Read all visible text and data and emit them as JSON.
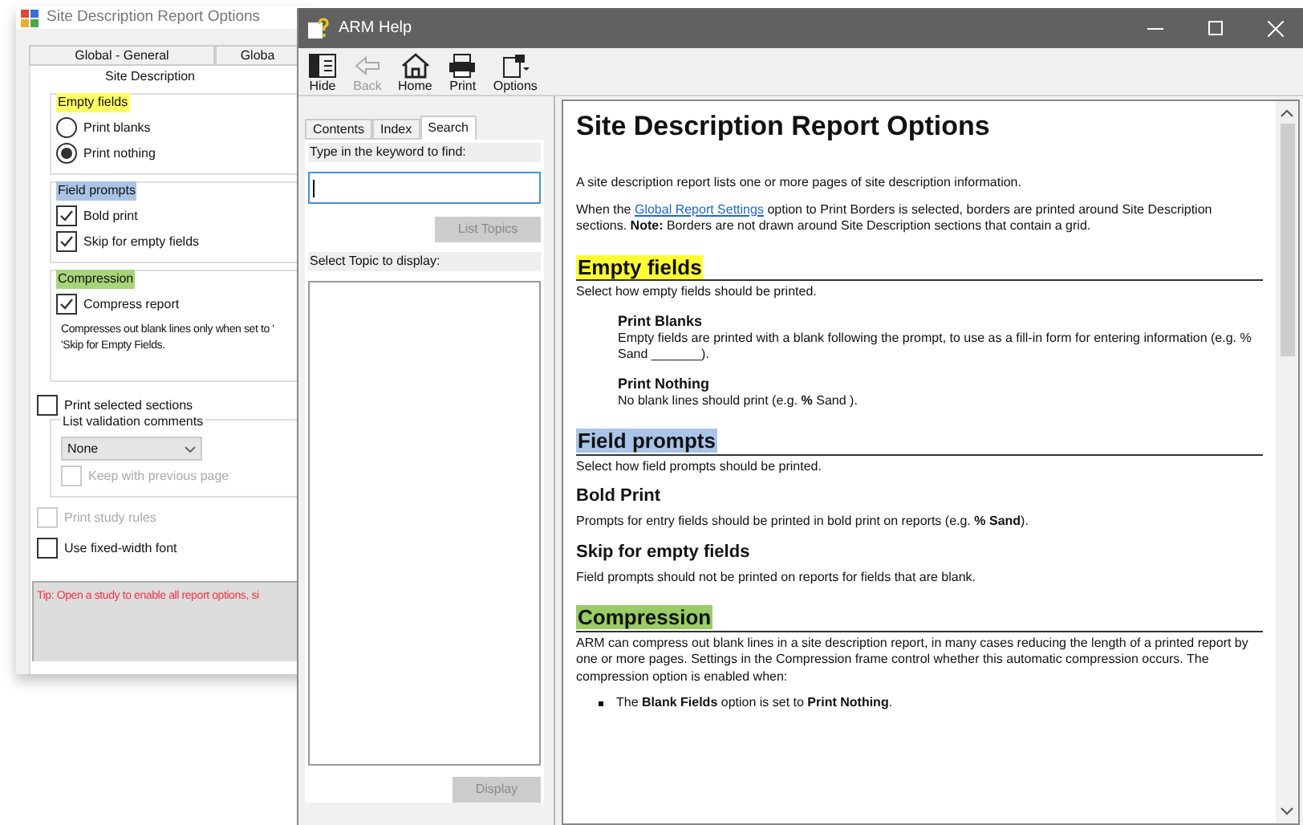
{
  "options_window": {
    "title": "Site Description Report Options",
    "tabs": [
      {
        "label": "Global - General",
        "selected": false
      },
      {
        "label": "Globa",
        "selected": false
      }
    ],
    "active_tab": {
      "label": "Site Description",
      "selected": true
    },
    "groups": [
      {
        "legend": "Empty fields",
        "color": "#ffff66",
        "items": [
          {
            "kind": "radio",
            "label": "Print blanks",
            "checked": false
          },
          {
            "kind": "radio",
            "label": "Print nothing",
            "checked": true
          }
        ]
      },
      {
        "legend": "Field prompts",
        "color": "#a9c4e6",
        "items": [
          {
            "kind": "checkbox",
            "label": "Bold print",
            "checked": true
          },
          {
            "kind": "checkbox",
            "label": "Skip for empty fields",
            "checked": true
          }
        ]
      },
      {
        "legend": "Compression",
        "color": "#a6d57a",
        "items": [
          {
            "kind": "checkbox",
            "label": "Compress report",
            "checked": true
          }
        ],
        "note": [
          "Compresses out blank lines only when set to '",
          "'Skip for Empty Fields."
        ]
      }
    ],
    "print_selected": {
      "label": "Print selected sections",
      "checked": false,
      "disabled": false
    },
    "validation": {
      "legend": "List validation comments",
      "value": "None",
      "keep": {
        "label": "Keep with previous page",
        "checked": false,
        "disabled": true
      }
    },
    "study_rules": {
      "label": "Print study rules",
      "checked": false,
      "disabled": true
    },
    "fixed_width": {
      "label": "Use fixed-width font",
      "checked": false,
      "disabled": false
    },
    "tip": "Tip: Open a study to enable all report options, si"
  },
  "help_window": {
    "title": "ARM Help",
    "toolbar": [
      {
        "kind": "hide",
        "label": "Hide",
        "disabled": false
      },
      {
        "kind": "back",
        "label": "Back",
        "disabled": true
      },
      {
        "kind": "home",
        "label": "Home",
        "disabled": false
      },
      {
        "kind": "print",
        "label": "Print",
        "disabled": false
      },
      {
        "kind": "options",
        "label": "Options",
        "disabled": false
      }
    ],
    "nav_tabs": [
      {
        "label": "Contents",
        "selected": false
      },
      {
        "label": "Index",
        "selected": false
      },
      {
        "label": "Search",
        "selected": true
      }
    ],
    "keyword_label": "Type in the keyword to find:",
    "list_topics": "List Topics",
    "topic_label": "Select Topic to display:",
    "display": "Display",
    "content": [
      {
        "kind": "title",
        "text": "Site Description Report Options"
      },
      {
        "kind": "para",
        "text": "A site description report lists one or more pages of site description information."
      },
      {
        "kind": "linkpara",
        "before": "When the ",
        "link": "Global Report Settings",
        "after": " option to Print Borders is selected, borders are printed around Site Description sections. **Note:** Borders are not drawn around Site Description sections that contain a grid."
      },
      {
        "kind": "section",
        "text": "Empty fields",
        "color": "#ffff33"
      },
      {
        "kind": "para",
        "text": "Select how empty fields should be printed."
      },
      {
        "kind": "subindent",
        "text": "Print Blanks"
      },
      {
        "kind": "paraindent",
        "text": "Empty fields are printed with a blank following the prompt, to use as a fill-in form for entering information (e.g. % Sand _______)."
      },
      {
        "kind": "subindent",
        "text": "Print Nothing"
      },
      {
        "kind": "paraindent",
        "text": "No blank lines should print (e.g. **%** Sand )."
      },
      {
        "kind": "section",
        "text": "Field prompts",
        "color": "#a9c4e6"
      },
      {
        "kind": "para",
        "text": "Select how field prompts should be printed."
      },
      {
        "kind": "sub",
        "text": "Bold Print"
      },
      {
        "kind": "para",
        "text": "Prompts for entry fields should be printed in bold print on reports (e.g. **% Sand**)."
      },
      {
        "kind": "sub",
        "text": "Skip for empty fields"
      },
      {
        "kind": "para",
        "text": "Field prompts should not be printed on reports for fields that are blank."
      },
      {
        "kind": "section",
        "text": "Compression",
        "color": "#99cc66"
      },
      {
        "kind": "para",
        "text": "ARM can compress out blank lines in a site description report, in many cases reducing the length of a printed report by one or more pages. Settings in the Compression frame control whether this automatic compression occurs. The compression option is enabled when:"
      },
      {
        "kind": "bullet",
        "text": "The **Blank Fields** option is set to **Print Nothing**."
      }
    ]
  }
}
